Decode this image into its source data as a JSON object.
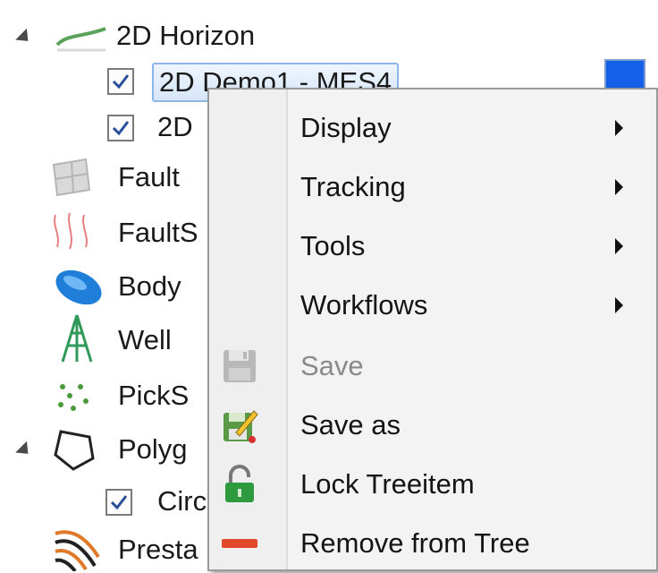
{
  "tree": {
    "items": [
      {
        "label": "2D Horizon"
      },
      {
        "label": "2D Demo1 - MES4"
      },
      {
        "label": "2D"
      },
      {
        "label": "Fault"
      },
      {
        "label": "FaultS"
      },
      {
        "label": "Body"
      },
      {
        "label": "Well"
      },
      {
        "label": "PickS"
      },
      {
        "label": "Polyg"
      },
      {
        "label": "Circ"
      },
      {
        "label": "Presta"
      }
    ],
    "swatch_color": "#1560e8"
  },
  "context_menu": {
    "items": [
      {
        "label": "Display",
        "has_submenu": true,
        "enabled": true
      },
      {
        "label": "Tracking",
        "has_submenu": true,
        "enabled": true
      },
      {
        "label": "Tools",
        "has_submenu": true,
        "enabled": true
      },
      {
        "label": "Workflows",
        "has_submenu": true,
        "enabled": true
      },
      {
        "label": "Save",
        "icon": "floppy-disk-icon",
        "enabled": false
      },
      {
        "label": "Save as",
        "icon": "save-as-icon",
        "enabled": true
      },
      {
        "label": "Lock Treeitem",
        "icon": "unlocked-padlock-icon",
        "enabled": true
      },
      {
        "label": "Remove from Tree",
        "icon": "remove-bar-icon",
        "enabled": true
      }
    ]
  }
}
